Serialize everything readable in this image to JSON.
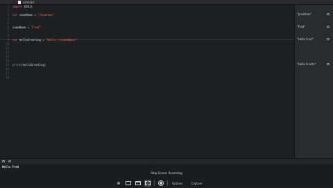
{
  "window": {
    "file_name": "Untitled"
  },
  "editor": {
    "line_numbers": [
      "1",
      "2",
      "3",
      "4",
      "5",
      "6",
      "7",
      "8",
      "9",
      "10",
      "11",
      "12",
      "13",
      "14",
      "15",
      "16",
      "17",
      "18"
    ],
    "lines": {
      "l1": {
        "kw": "import",
        "rest": " UIKit"
      },
      "l3": {
        "kw": "var",
        "name": " someName = ",
        "str": "\"Jonathan\""
      },
      "l6": {
        "name": "someName = ",
        "str": "\"Fred\""
      },
      "l9": {
        "kw": "var",
        "name": " helloGreeting = ",
        "str": "\"Hello \\(someName)\""
      },
      "l15": {
        "fn": "print",
        "rest": "(helloGreeting)"
      }
    }
  },
  "results": {
    "r3": "\"Jonathan\"",
    "r6": "\"Fred\"",
    "r9": "\"Hello Fred\"",
    "r15": "\"Hello Fred\\n\""
  },
  "console": {
    "output": "Hello Fred"
  },
  "screen_recording": {
    "label": "Stop Screen Recording",
    "options": "Options",
    "capture": "Capture"
  }
}
